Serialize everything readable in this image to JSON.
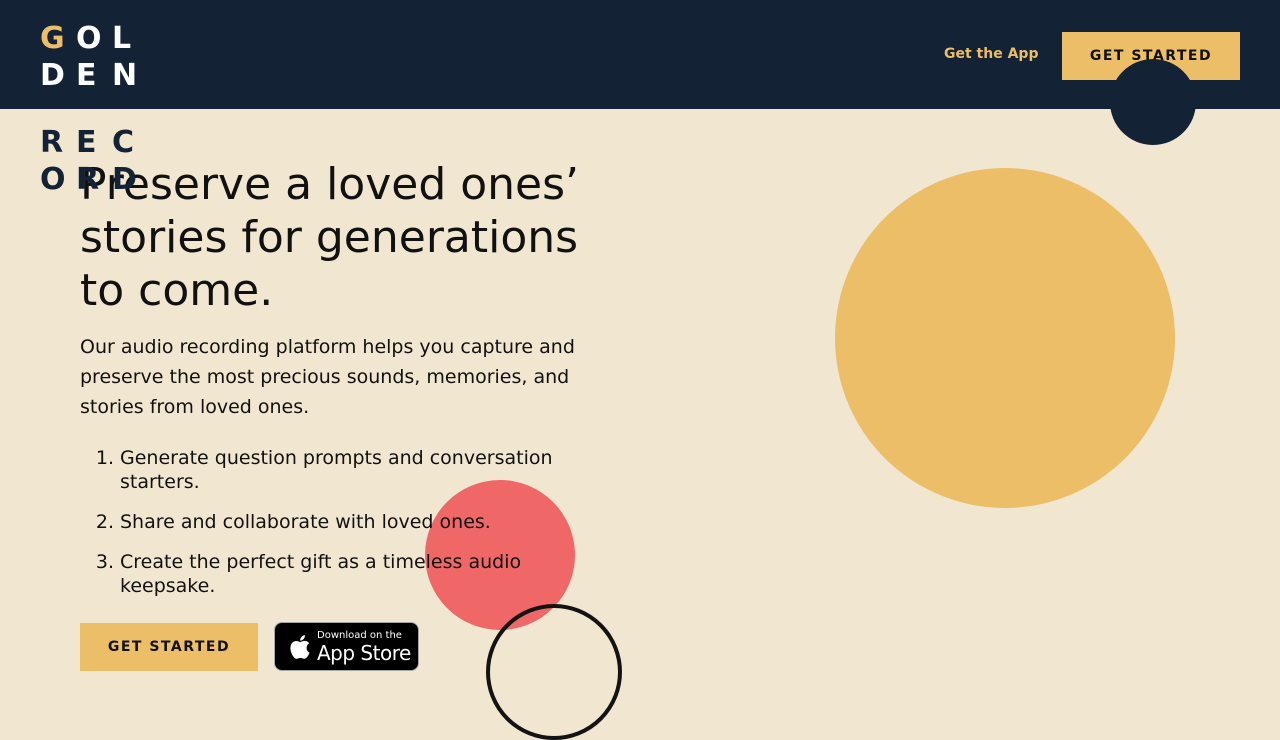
{
  "header": {
    "logo_letters": [
      [
        "G",
        "O",
        "L"
      ],
      [
        "D",
        "E",
        "N"
      ],
      [
        "R",
        "E",
        "C"
      ],
      [
        "O",
        "R",
        "D"
      ]
    ],
    "nav_link": "Get the App",
    "cta_label": "GET STARTED"
  },
  "hero": {
    "title": "Preserve a loved ones’ stories for generations to come.",
    "description": "Our audio recording platform helps you capture and preserve the most precious sounds, memories, and stories from loved ones.",
    "steps": [
      {
        "number": "1.",
        "text": "Generate question prompts and conversation starters."
      },
      {
        "number": "2.",
        "text": "Share and collaborate with loved ones."
      },
      {
        "number": "3.",
        "text": "Create the perfect gift as a timeless audio keepsake."
      }
    ],
    "cta_label": "GET STARTED",
    "appstore": {
      "small": "Download on the",
      "big": "App Store"
    }
  },
  "colors": {
    "navy": "#132235",
    "gold": "#ecbe67",
    "coral": "#ef6767",
    "cream": "#f1e6d0"
  },
  "icons": [
    "apple-icon"
  ]
}
